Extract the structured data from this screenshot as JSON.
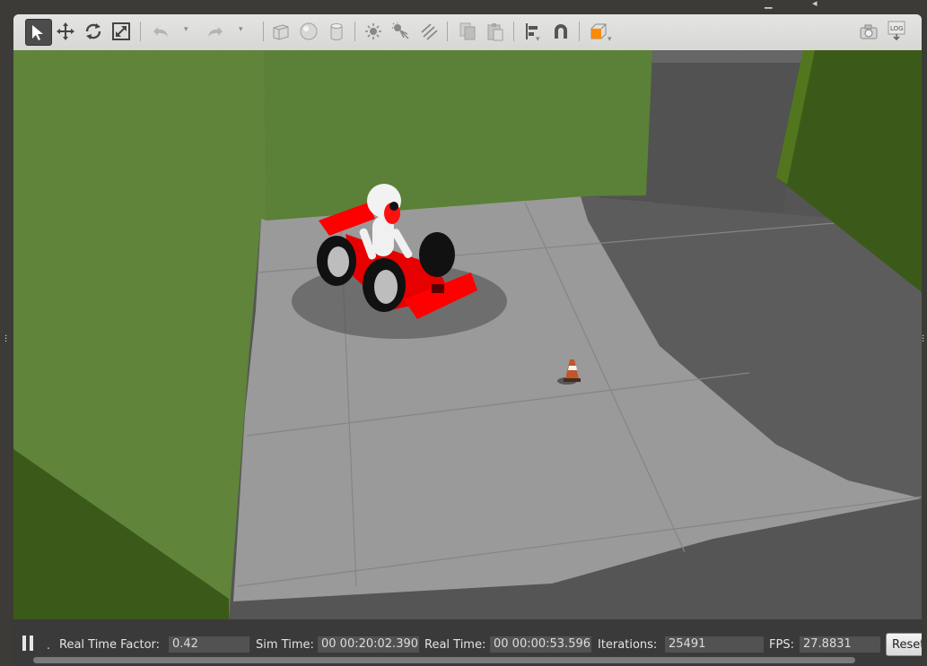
{
  "toolbar": {
    "tools": [
      {
        "name": "select-mode-icon",
        "active": true
      },
      {
        "name": "translate-mode-icon"
      },
      {
        "name": "rotate-mode-icon"
      },
      {
        "name": "scale-mode-icon"
      },
      {
        "name": "undo-icon"
      },
      {
        "name": "redo-icon"
      },
      {
        "name": "box-shape-icon"
      },
      {
        "name": "sphere-shape-icon"
      },
      {
        "name": "cylinder-shape-icon"
      },
      {
        "name": "point-light-icon"
      },
      {
        "name": "spot-light-icon"
      },
      {
        "name": "directional-light-icon"
      },
      {
        "name": "copy-icon"
      },
      {
        "name": "paste-icon"
      },
      {
        "name": "align-icon"
      },
      {
        "name": "snap-icon"
      },
      {
        "name": "view-angle-icon"
      },
      {
        "name": "screenshot-icon"
      },
      {
        "name": "log-icon"
      }
    ],
    "log_label": "LOG"
  },
  "scene": {
    "colors": {
      "wall_green": "#5f843a",
      "wall_dark_green": "#3b5a1a",
      "floor_light": "#9a9a9a",
      "floor_shadow": "#5a5a5a",
      "kart_red": "#ff0000",
      "cone_orange": "#c0562a"
    },
    "objects": [
      "green-walls",
      "concrete-floor",
      "go-kart-with-driver",
      "traffic-cone"
    ]
  },
  "status": {
    "step_label": ".",
    "real_time_factor_label": "Real Time Factor:",
    "real_time_factor_value": "0.42",
    "sim_time_label": "Sim Time:",
    "sim_time_value": "00 00:20:02.390",
    "real_time_label": "Real Time:",
    "real_time_value": "00 00:00:53.596",
    "iterations_label": "Iterations:",
    "iterations_value": "25491",
    "fps_label": "FPS:",
    "fps_value": "27.8831",
    "reset_label": "Reset"
  }
}
